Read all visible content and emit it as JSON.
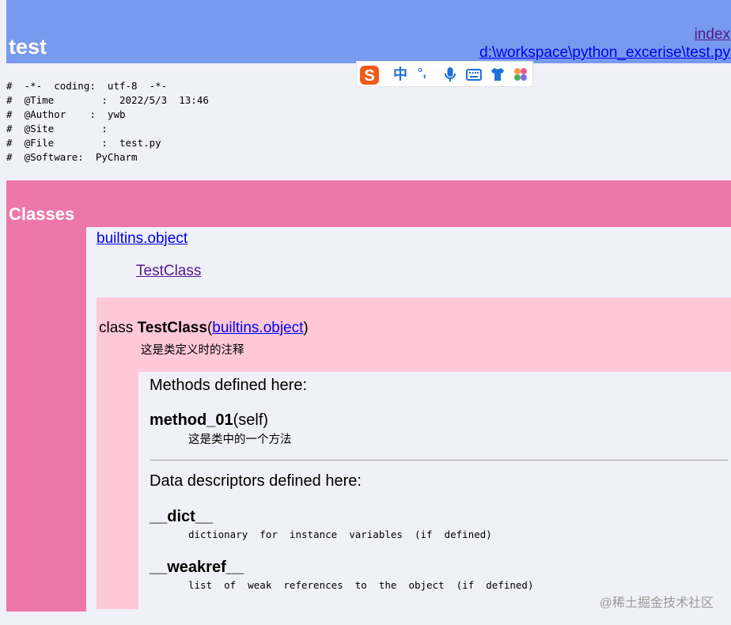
{
  "header": {
    "title": "test",
    "index_link": "index",
    "path_link": "d:\\workspace\\python_excerise\\test.py"
  },
  "ime_toolbar": {
    "mode_label": "中",
    "punct_label": "°,",
    "icons": [
      "sogou-logo-icon",
      "punctuation-icon",
      "microphone-icon",
      "keyboard-icon",
      "shirt-icon",
      "toolbox-icon"
    ]
  },
  "header_comments": "#  -*-  coding:  utf-8  -*-\n#  @Time        :  2022/5/3  13:46\n#  @Author    :  ywb\n#  @Site        :\n#  @File        :  test.py\n#  @Software:  PyCharm",
  "classes": {
    "section_title": "Classes",
    "base_link": "builtins.object",
    "class_link": "TestClass",
    "class_keyword": "class ",
    "class_name": "TestClass",
    "paren_open": "(",
    "base_in_sig": "builtins.object",
    "paren_close": ")",
    "class_doc": "这是类定义时的注释",
    "methods_heading": "Methods defined here:",
    "method_name": "method_01",
    "method_args": "(self)",
    "method_doc": "这是类中的一个方法",
    "data_heading": "Data descriptors defined here:",
    "descriptors": [
      {
        "name": "__dict__",
        "doc": "dictionary  for  instance  variables  (if  defined)"
      },
      {
        "name": "__weakref__",
        "doc": "list  of  weak  references  to  the  object  (if  defined)"
      }
    ]
  },
  "watermark": "@稀土掘金技术社区",
  "colors": {
    "header_band": "#7799ee",
    "classes_band": "#ee77aa",
    "class_box": "#ffc8d8",
    "page_bg": "#f0f0f8"
  }
}
